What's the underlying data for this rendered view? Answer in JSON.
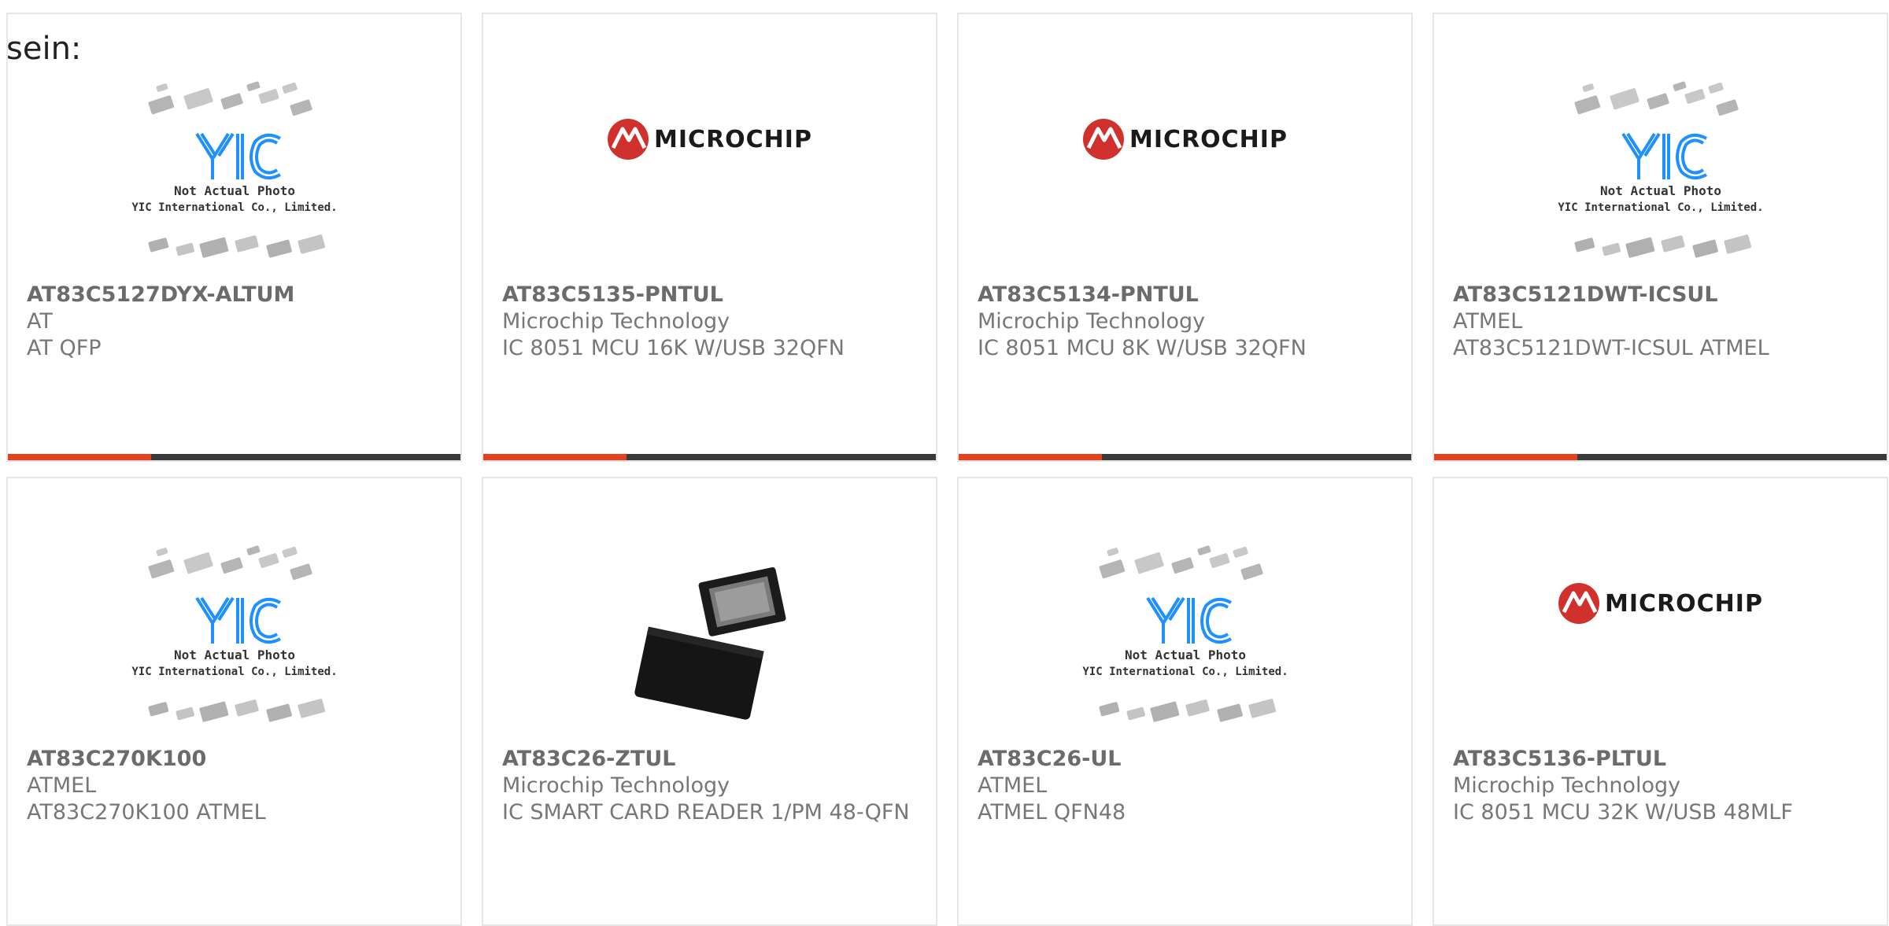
{
  "intro_text": "sein:",
  "placeholder": {
    "line1": "Not Actual Photo",
    "line2": "YIC International Co., Limited.",
    "logo": "YIC"
  },
  "brand_logo": "MICROCHIP",
  "colors": {
    "accent": "#e8401c",
    "bar": "#3a3a3a",
    "microchip_red": "#d0312d",
    "yic_blue": "#1e90ff"
  },
  "products": [
    {
      "part": "AT83C5127DYX-ALTUM",
      "manufacturer": "AT",
      "description": "AT QFP",
      "image": "placeholder"
    },
    {
      "part": "AT83C5135-PNTUL",
      "manufacturer": "Microchip Technology",
      "description": "IC 8051 MCU 16K W/USB 32QFN",
      "image": "microchip-logo"
    },
    {
      "part": "AT83C5134-PNTUL",
      "manufacturer": "Microchip Technology",
      "description": "IC 8051 MCU 8K W/USB 32QFN",
      "image": "microchip-logo"
    },
    {
      "part": "AT83C5121DWT-ICSUL",
      "manufacturer": "ATMEL",
      "description": "AT83C5121DWT-ICSUL ATMEL",
      "image": "placeholder"
    },
    {
      "part": "AT83C270K100",
      "manufacturer": "ATMEL",
      "description": "AT83C270K100 ATMEL",
      "image": "placeholder"
    },
    {
      "part": "AT83C26-ZTUL",
      "manufacturer": "Microchip Technology",
      "description": "IC SMART CARD READER 1/PM 48-QFN",
      "image": "chip-photo"
    },
    {
      "part": "AT83C26-UL",
      "manufacturer": "ATMEL",
      "description": "ATMEL QFN48",
      "image": "placeholder"
    },
    {
      "part": "AT83C5136-PLTUL",
      "manufacturer": "Microchip Technology",
      "description": "IC 8051 MCU 32K W/USB 48MLF",
      "image": "microchip-logo"
    }
  ]
}
